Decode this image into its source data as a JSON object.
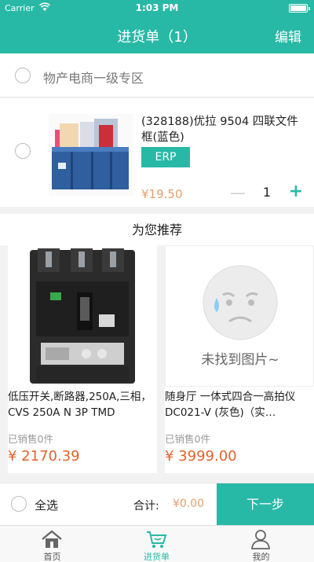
{
  "status_bar": {
    "carrier": "Carrier",
    "time": "1:03 PM"
  },
  "nav": {
    "title": "进货单（1）",
    "edit_label": "编辑"
  },
  "section": {
    "label": "物产电商一级专区"
  },
  "cart_item": {
    "name": "(328188)优拉 9504 四联文件框(蓝色)",
    "tag": "ERP",
    "price": "¥19.50",
    "quantity": "1",
    "minus_label": "—",
    "plus_label": "+"
  },
  "recommend": {
    "title": "为您推荐",
    "items": [
      {
        "name": "低压开关,断路器,250A,三相，CVS 250A N 3P TMD",
        "sold": "已销售0件",
        "price": "¥ 2170.39"
      },
      {
        "name": "随身厅 一体式四合一高拍仪 DC021-V (灰色)（实…",
        "sold": "已销售0件",
        "price": "¥ 3999.00",
        "placeholder_text": "未找到图片~"
      }
    ]
  },
  "bottom_bar": {
    "select_all": "全选",
    "total_label": "合计:",
    "total_value": "¥0.00",
    "next_label": "下一步"
  },
  "tabs": [
    {
      "label": "首页",
      "icon": "home-icon"
    },
    {
      "label": "进货单",
      "icon": "cart-icon"
    },
    {
      "label": "我的",
      "icon": "user-icon"
    }
  ],
  "colors": {
    "accent": "#28b9a6",
    "price": "#e2a06d",
    "rec_price": "#e2622b"
  }
}
